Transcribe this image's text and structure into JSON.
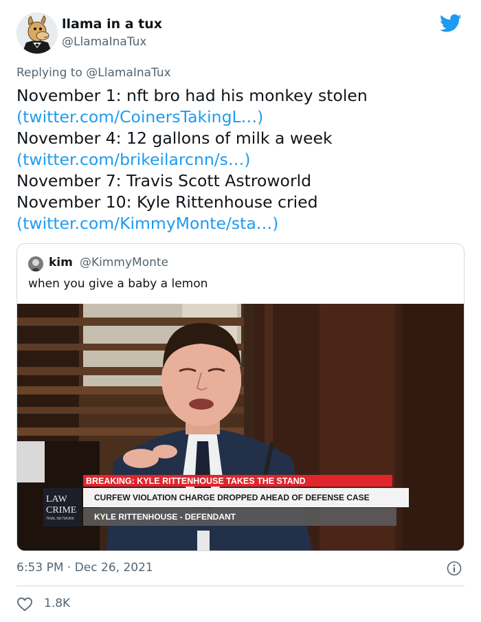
{
  "tweet": {
    "display_name": "llama in a tux",
    "handle": "@LlamaInaTux",
    "reply_prefix": "Replying to",
    "reply_mention": "@LlamaInaTux",
    "lines": [
      {
        "text": "November 1: nft bro had his monkey stolen",
        "link": ""
      },
      {
        "text": "",
        "link": "(twitter.com/CoinersTakingL…)"
      },
      {
        "text": "November 4: 12 gallons of milk a week",
        "link": ""
      },
      {
        "text": "",
        "link": "(twitter.com/brikeilarcnn/s…)"
      },
      {
        "text": "November 7: Travis Scott Astroworld",
        "link": ""
      },
      {
        "text": "November 10: Kyle Rittenhouse cried",
        "link": ""
      },
      {
        "text": "",
        "link": "(twitter.com/KimmyMonte/sta…)"
      }
    ],
    "timestamp": "6:53 PM · Dec 26, 2021",
    "likes": "1.8K"
  },
  "quote": {
    "display_name": "kim",
    "handle": "@KimmyMonte",
    "text": "when you give a baby a lemon",
    "media": {
      "banner_breaking": "BREAKING: KYLE RITTENHOUSE TAKES THE STAND",
      "banner_sub": "CURFEW VIOLATION CHARGE DROPPED AHEAD OF DEFENSE CASE",
      "banner_name": "KYLE RITTENHOUSE - DEFENDANT",
      "logo_line1": "LAW",
      "logo_line2": "CRIME",
      "logo_line3": "TRIAL NETWORK"
    }
  },
  "colors": {
    "link": "#1d9bf0",
    "secondary_text": "#536471",
    "twitter_blue": "#1d9bf0",
    "breaking_red": "#e0262b"
  },
  "icons": {
    "brand": "twitter-bird-icon",
    "info": "info-icon",
    "like": "heart-icon"
  }
}
